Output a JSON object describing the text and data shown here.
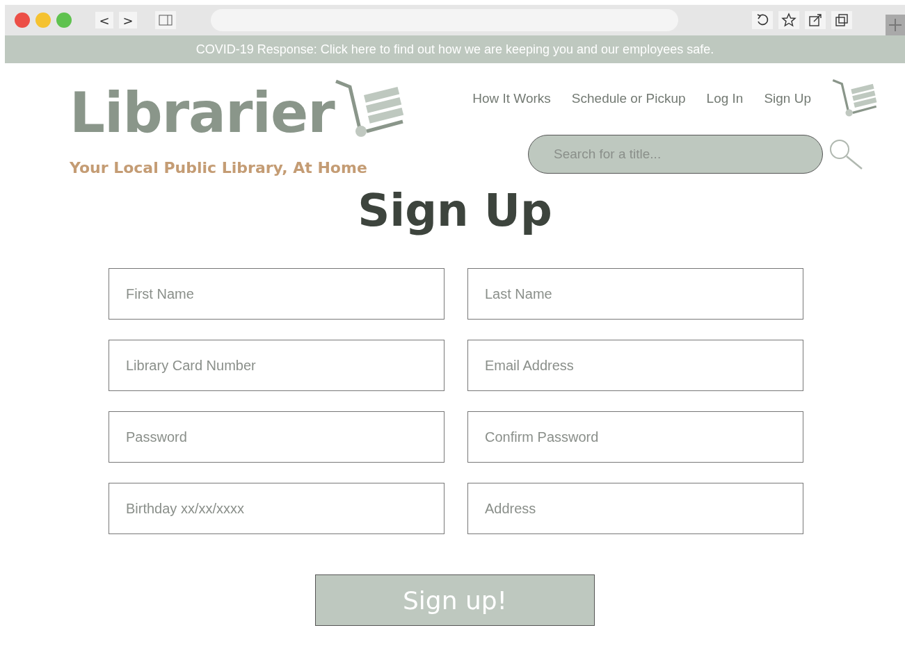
{
  "browser": {
    "back": "<",
    "forward": ">"
  },
  "banner": "COVID-19 Response: Click here to find out how we are keeping you and our employees safe.",
  "logo": {
    "name": "Librarier",
    "tagline": "Your Local Public Library, At Home"
  },
  "nav": [
    "How It Works",
    "Schedule or Pickup",
    "Log In",
    "Sign Up"
  ],
  "search": {
    "placeholder": "Search for a title..."
  },
  "title": "Sign Up",
  "fields": [
    {
      "placeholder": "First Name"
    },
    {
      "placeholder": "Last Name"
    },
    {
      "placeholder": "Library Card Number"
    },
    {
      "placeholder": "Email Address"
    },
    {
      "placeholder": "Password"
    },
    {
      "placeholder": "Confirm Password"
    },
    {
      "placeholder": "Birthday xx/xx/xxxx"
    },
    {
      "placeholder": "Address"
    }
  ],
  "submit": "Sign up!"
}
